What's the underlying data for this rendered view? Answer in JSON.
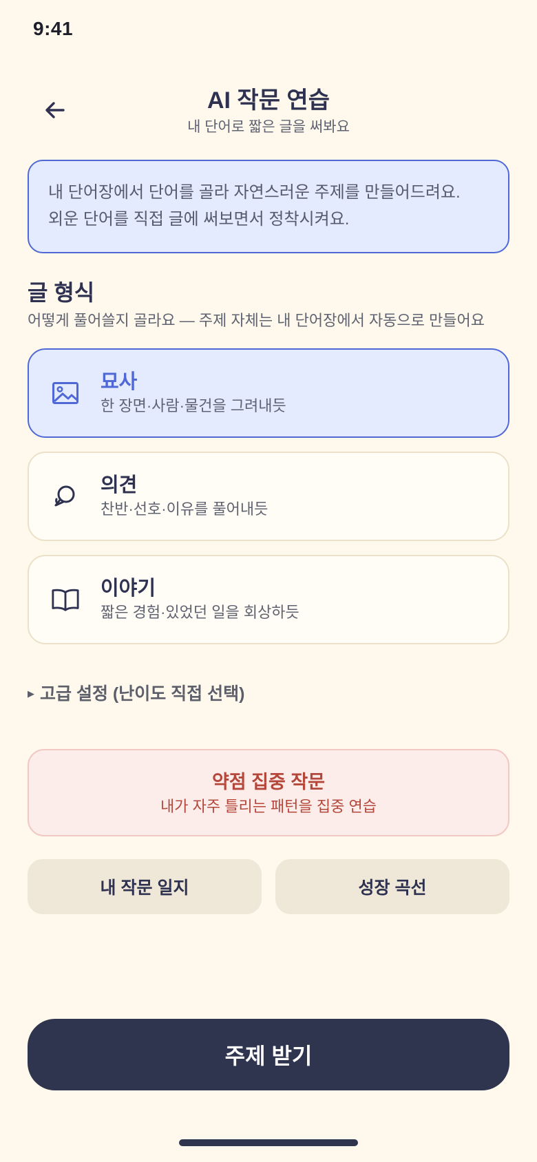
{
  "status_bar": {
    "time": "9:41"
  },
  "header": {
    "title": "AI 작문 연습",
    "subtitle": "내 단어로 짧은 글을 써봐요"
  },
  "info": {
    "lines": [
      "내 단어장에서 단어를 골라 자연스러운 주제를 만들어드려요.",
      "외운 단어를 직접 글에 써보면서 정착시켜요."
    ]
  },
  "format_section": {
    "title": "글 형식",
    "description": "어떻게 풀어쓸지 골라요 — 주제 자체는 내 단어장에서 자동으로 만들어요",
    "options": [
      {
        "title": "묘사",
        "description": "한 장면·사람·물건을 그려내듯",
        "icon": "image-icon",
        "selected": true
      },
      {
        "title": "의견",
        "description": "찬반·선호·이유를 풀어내듯",
        "icon": "speech-bubble-icon",
        "selected": false
      },
      {
        "title": "이야기",
        "description": "짧은 경험·있었던 일을 회상하듯",
        "icon": "open-book-icon",
        "selected": false
      }
    ]
  },
  "advanced": {
    "label": "고급 설정 (난이도 직접 선택)"
  },
  "weak_focus": {
    "title": "약점 집중 작문",
    "description": "내가 자주 틀리는 패턴을 집중 연습"
  },
  "secondary_buttons": {
    "journal": "내 작문 일지",
    "growth": "성장 곡선"
  },
  "primary_button": {
    "label": "주제 받기"
  },
  "colors": {
    "background": "#FEF9EC",
    "accent": "#4F68D6",
    "primary": "#2F344F",
    "warning": "#B5473A"
  }
}
